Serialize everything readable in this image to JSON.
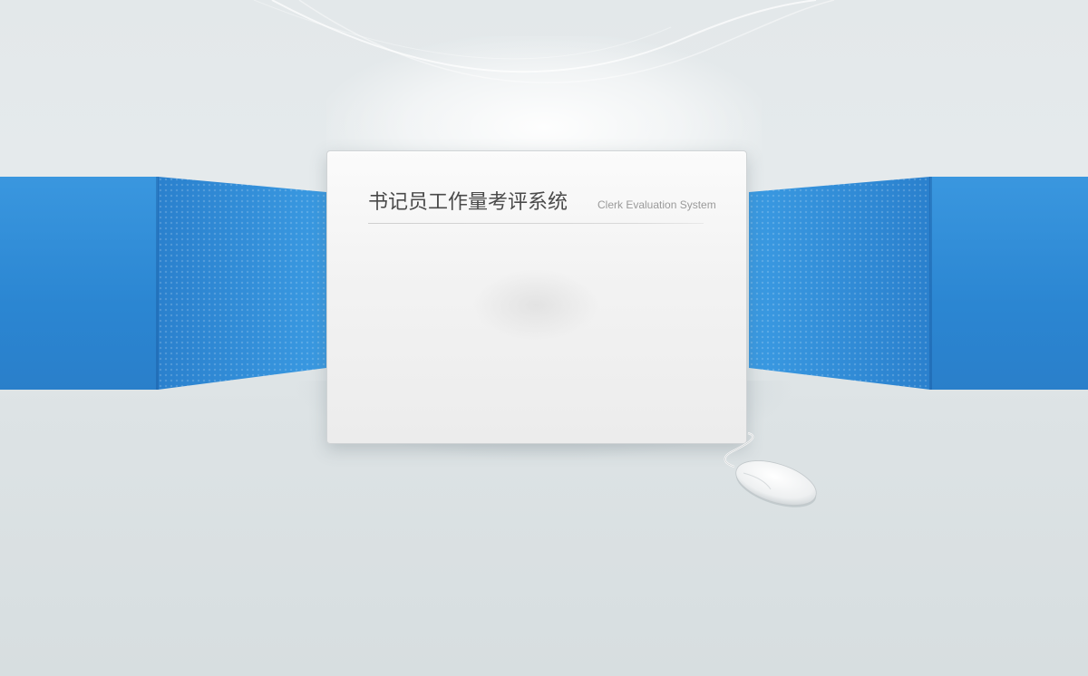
{
  "panel": {
    "title": "书记员工作量考评系统",
    "subtitle": "Clerk Evaluation System"
  },
  "colors": {
    "wall_blue": "#2b86d2",
    "wall_blue_light": "#3a9ae2",
    "background": "#e3e8ea",
    "panel_bg": "#f3f3f3",
    "title_text": "#4a4a4a",
    "subtitle_text": "#9a9a9a"
  },
  "icons": {
    "mouse": "computer-mouse-icon"
  }
}
